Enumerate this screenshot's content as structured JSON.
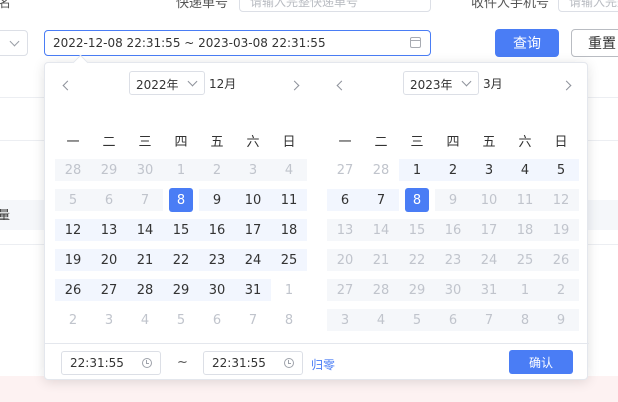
{
  "background": {
    "label_left": "名",
    "label_tracking": "快递单号",
    "tracking_placeholder": "请输入完整快递单号",
    "label_phone": "收件人手机号",
    "phone_placeholder": "请输入完整",
    "side_text": "量"
  },
  "range_input": {
    "value": "2022-12-08 22:31:55 ~ 2023-03-08 22:31:55"
  },
  "buttons": {
    "query": "查询",
    "reset": "重置"
  },
  "picker": {
    "weekdays": [
      "一",
      "二",
      "三",
      "四",
      "五",
      "六",
      "日"
    ],
    "left": {
      "year": "2022年",
      "month": "12月",
      "rows": [
        [
          {
            "d": "28",
            "s": "disabled"
          },
          {
            "d": "29",
            "s": "disabled"
          },
          {
            "d": "30",
            "s": "disabled"
          },
          {
            "d": "1",
            "s": "disabled"
          },
          {
            "d": "2",
            "s": "disabled"
          },
          {
            "d": "3",
            "s": "disabled"
          },
          {
            "d": "4",
            "s": "disabled"
          }
        ],
        [
          {
            "d": "5",
            "s": "disabled"
          },
          {
            "d": "6",
            "s": "disabled"
          },
          {
            "d": "7",
            "s": "disabled"
          },
          {
            "d": "8",
            "s": "sel"
          },
          {
            "d": "9",
            "s": "inrange"
          },
          {
            "d": "10",
            "s": "inrange"
          },
          {
            "d": "11",
            "s": "inrange"
          }
        ],
        [
          {
            "d": "12",
            "s": "inrange"
          },
          {
            "d": "13",
            "s": "inrange"
          },
          {
            "d": "14",
            "s": "inrange"
          },
          {
            "d": "15",
            "s": "inrange"
          },
          {
            "d": "16",
            "s": "inrange"
          },
          {
            "d": "17",
            "s": "inrange"
          },
          {
            "d": "18",
            "s": "inrange"
          }
        ],
        [
          {
            "d": "19",
            "s": "inrange"
          },
          {
            "d": "20",
            "s": "inrange"
          },
          {
            "d": "21",
            "s": "inrange"
          },
          {
            "d": "22",
            "s": "inrange"
          },
          {
            "d": "23",
            "s": "inrange"
          },
          {
            "d": "24",
            "s": "inrange"
          },
          {
            "d": "25",
            "s": "inrange"
          }
        ],
        [
          {
            "d": "26",
            "s": "inrange"
          },
          {
            "d": "27",
            "s": "inrange"
          },
          {
            "d": "28",
            "s": "inrange"
          },
          {
            "d": "29",
            "s": "inrange"
          },
          {
            "d": "30",
            "s": "inrange"
          },
          {
            "d": "31",
            "s": "inrange"
          },
          {
            "d": "1",
            "s": "muted"
          }
        ],
        [
          {
            "d": "2",
            "s": "muted"
          },
          {
            "d": "3",
            "s": "muted"
          },
          {
            "d": "4",
            "s": "muted"
          },
          {
            "d": "5",
            "s": "muted"
          },
          {
            "d": "6",
            "s": "muted"
          },
          {
            "d": "7",
            "s": "muted"
          },
          {
            "d": "8",
            "s": "muted"
          }
        ]
      ]
    },
    "right": {
      "year": "2023年",
      "month": "3月",
      "rows": [
        [
          {
            "d": "27",
            "s": "muted"
          },
          {
            "d": "28",
            "s": "muted"
          },
          {
            "d": "1",
            "s": "inrange"
          },
          {
            "d": "2",
            "s": "inrange"
          },
          {
            "d": "3",
            "s": "inrange"
          },
          {
            "d": "4",
            "s": "inrange"
          },
          {
            "d": "5",
            "s": "inrange"
          }
        ],
        [
          {
            "d": "6",
            "s": "inrange"
          },
          {
            "d": "7",
            "s": "inrange"
          },
          {
            "d": "8",
            "s": "sel"
          },
          {
            "d": "9",
            "s": "disabled"
          },
          {
            "d": "10",
            "s": "disabled"
          },
          {
            "d": "11",
            "s": "disabled"
          },
          {
            "d": "12",
            "s": "disabled"
          }
        ],
        [
          {
            "d": "13",
            "s": "disabled"
          },
          {
            "d": "14",
            "s": "disabled"
          },
          {
            "d": "15",
            "s": "disabled"
          },
          {
            "d": "16",
            "s": "disabled"
          },
          {
            "d": "17",
            "s": "disabled"
          },
          {
            "d": "18",
            "s": "disabled"
          },
          {
            "d": "19",
            "s": "disabled"
          }
        ],
        [
          {
            "d": "20",
            "s": "disabled"
          },
          {
            "d": "21",
            "s": "disabled"
          },
          {
            "d": "22",
            "s": "disabled"
          },
          {
            "d": "23",
            "s": "disabled"
          },
          {
            "d": "24",
            "s": "disabled"
          },
          {
            "d": "25",
            "s": "disabled"
          },
          {
            "d": "26",
            "s": "disabled"
          }
        ],
        [
          {
            "d": "27",
            "s": "disabled"
          },
          {
            "d": "28",
            "s": "disabled"
          },
          {
            "d": "29",
            "s": "disabled"
          },
          {
            "d": "30",
            "s": "disabled"
          },
          {
            "d": "31",
            "s": "disabled"
          },
          {
            "d": "1",
            "s": "disabled"
          },
          {
            "d": "2",
            "s": "disabled"
          }
        ],
        [
          {
            "d": "3",
            "s": "disabled"
          },
          {
            "d": "4",
            "s": "disabled"
          },
          {
            "d": "5",
            "s": "disabled"
          },
          {
            "d": "6",
            "s": "disabled"
          },
          {
            "d": "7",
            "s": "disabled"
          },
          {
            "d": "8",
            "s": "disabled"
          },
          {
            "d": "9",
            "s": "disabled"
          }
        ]
      ]
    },
    "start_time": "22:31:55",
    "separator": "~",
    "end_time": "22:31:55",
    "reset_label": "归零",
    "confirm_label": "确认"
  },
  "colors": {
    "accent": "#4a7df5",
    "range_bg": "#f2f6fe",
    "disabled_bg": "#f5f7fa"
  }
}
